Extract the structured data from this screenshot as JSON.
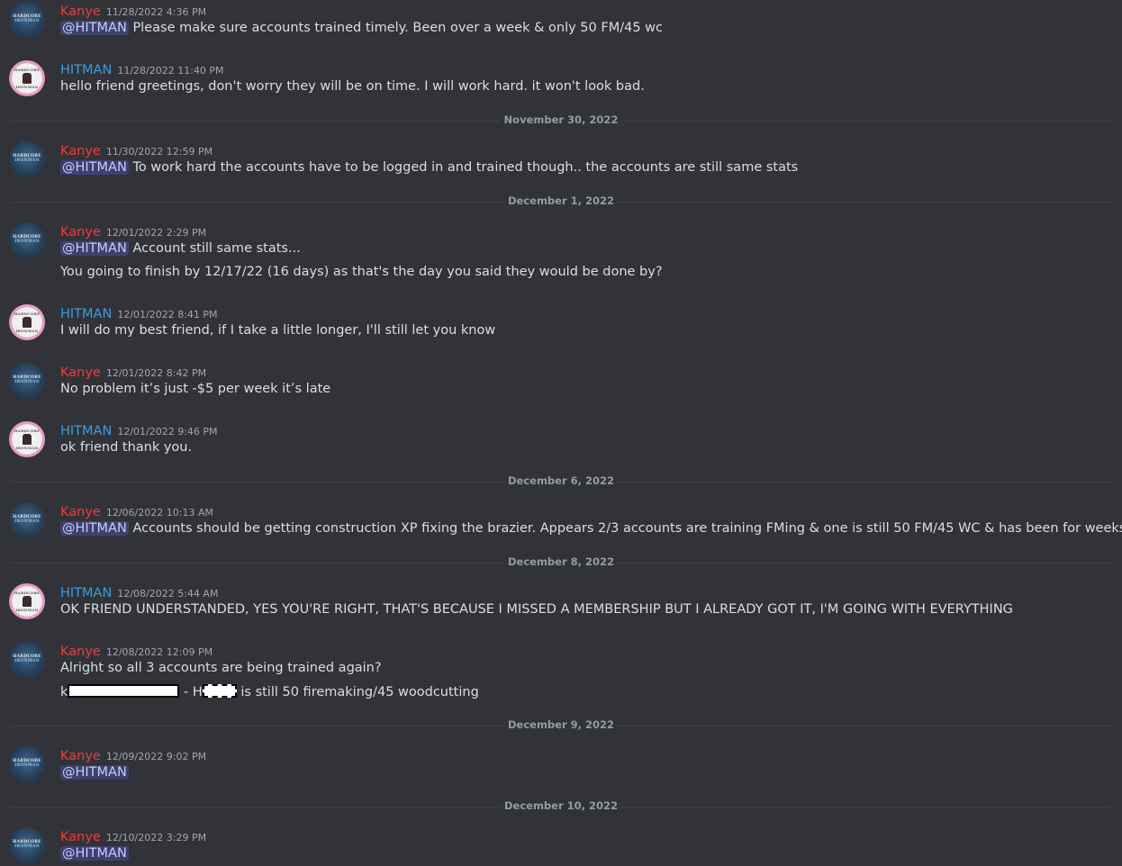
{
  "messages": [
    {
      "author": "Kanye",
      "time": "11/28/2022 4:36 PM",
      "mention": "@HITMAN",
      "text": "Please make sure accounts trained timely. Been over a week & only 50 FM/45 wc"
    },
    {
      "author": "HITMAN",
      "time": "11/28/2022 11:40 PM",
      "text": "hello friend greetings, don't worry they will be on time. I will work hard. it won't look bad."
    },
    {
      "author": "Kanye",
      "time": "11/30/2022 12:59 PM",
      "mention": "@HITMAN",
      "text": "To work hard the accounts have to be logged in and trained though.. the accounts are still same stats"
    },
    {
      "author": "Kanye",
      "time": "12/01/2022 2:29 PM",
      "mention": "@HITMAN",
      "text": "Account still same stats...",
      "text2": "You going to finish by 12/17/22 (16 days) as that's the day you said they would be done by?"
    },
    {
      "author": "HITMAN",
      "time": "12/01/2022 8:41 PM",
      "text": "I will do my best friend, if I take a little longer, I'll still let you know"
    },
    {
      "author": "Kanye",
      "time": "12/01/2022 8:42 PM",
      "text": "No problem it’s just -$5 per week it’s late"
    },
    {
      "author": "HITMAN",
      "time": "12/01/2022 9:46 PM",
      "text": "ok friend thank you."
    },
    {
      "author": "Kanye",
      "time": "12/06/2022 10:13 AM",
      "mention": "@HITMAN",
      "text": "Accounts should be getting construction XP fixing the brazier. Appears 2/3 accounts are training FMing & one is still 50 FM/45 WC & has been for weeks now"
    },
    {
      "author": "HITMAN",
      "time": "12/08/2022 5:44 AM",
      "text": "OK FRIEND UNDERSTANDED, YES YOU'RE RIGHT, THAT'S BECAUSE I MISSED A MEMBERSHIP BUT I ALREADY GOT IT, I'M GOING WITH EVERYTHING"
    },
    {
      "author": "Kanye",
      "time": "12/08/2022 12:09 PM",
      "text": "Alright so all 3 accounts are being trained again?",
      "redacted_prefix": "k",
      "redacted_mid": "- H",
      "text2": "is still 50 firemaking/45 woodcutting"
    },
    {
      "author": "Kanye",
      "time": "12/09/2022 9:02 PM",
      "mention": "@HITMAN"
    },
    {
      "author": "Kanye",
      "time": "12/10/2022 3:29 PM",
      "mention": "@HITMAN"
    }
  ],
  "dividers": [
    "November 30, 2022",
    "December 1, 2022",
    "December 6, 2022",
    "December 8, 2022",
    "December 9, 2022",
    "December 10, 2022"
  ],
  "avatars": {
    "kanye": {
      "line1": "HARDCORE",
      "line2": "IRONMAN"
    },
    "hitman": {
      "line1": "HARDCORE",
      "line2": "IRONMAN"
    }
  },
  "colors": {
    "background": "#313338",
    "kanye": "#ef3c3c",
    "hitman": "#3b9ae0",
    "mention_bg": "#3c4270"
  }
}
